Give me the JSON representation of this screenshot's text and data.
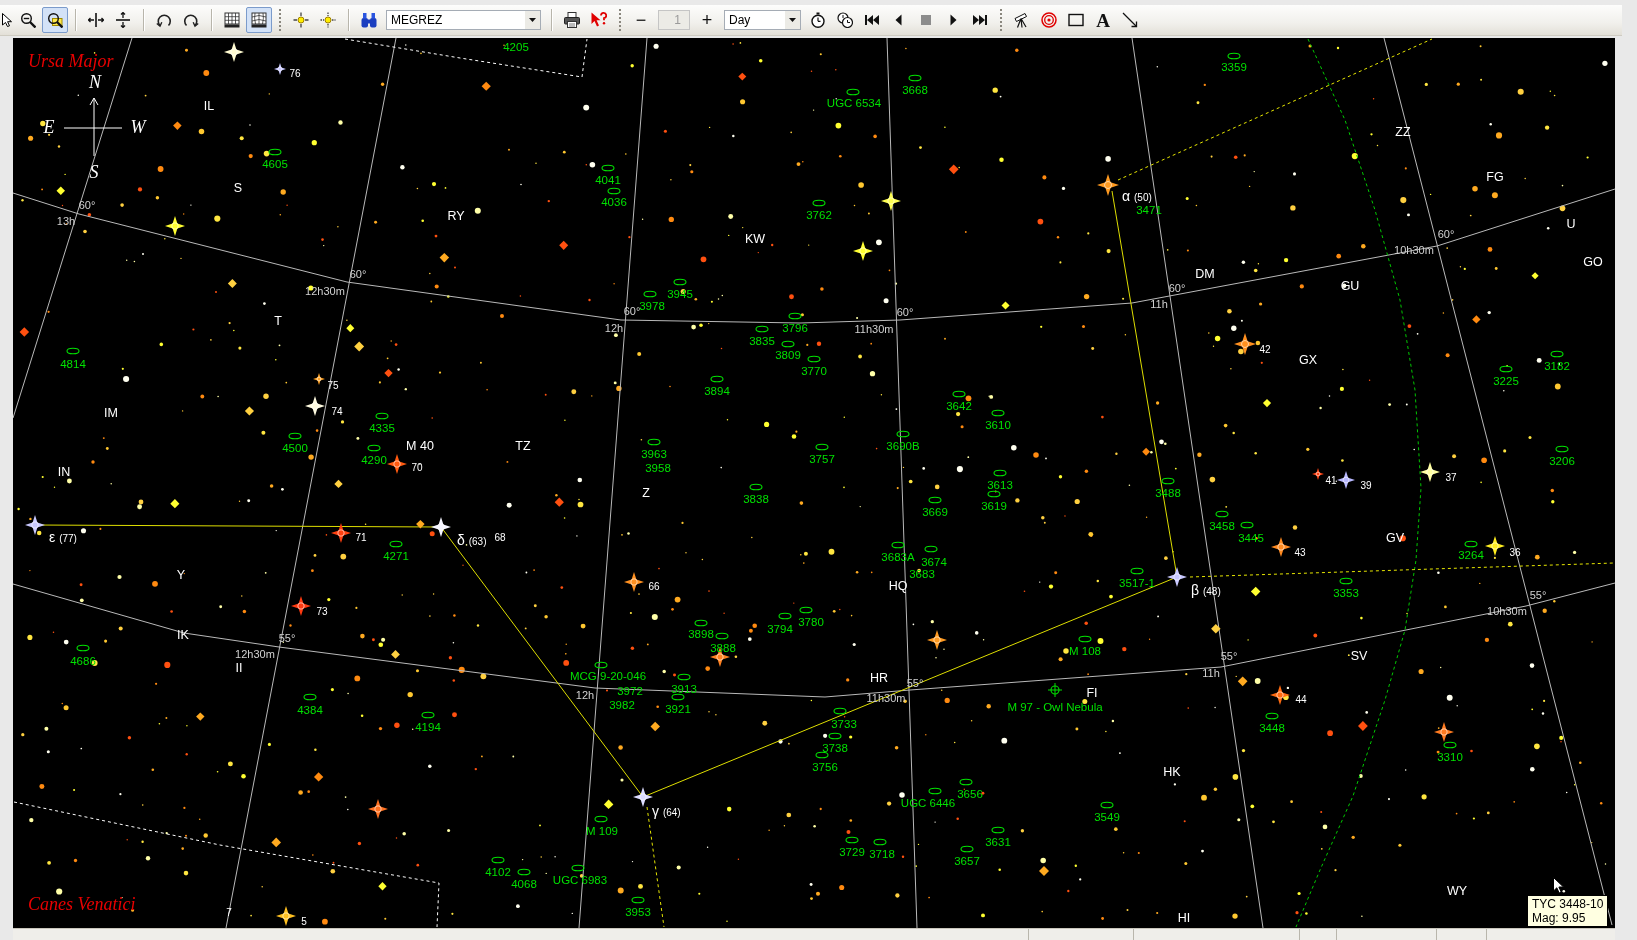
{
  "toolbar": {
    "items": [
      {
        "kind": "pointer",
        "selected": false
      },
      {
        "kind": "zoomout",
        "selected": false
      },
      {
        "kind": "zoomwindow",
        "selected": true
      },
      {
        "kind": "separator"
      },
      {
        "kind": "fliph",
        "selected": false
      },
      {
        "kind": "flipv",
        "selected": false
      },
      {
        "kind": "separator"
      },
      {
        "kind": "rotleft",
        "selected": false
      },
      {
        "kind": "rotright",
        "selected": false
      },
      {
        "kind": "separator"
      },
      {
        "kind": "grid",
        "selected": false
      },
      {
        "kind": "gridcurved",
        "selected": true
      },
      {
        "kind": "grip"
      },
      {
        "kind": "centera",
        "selected": false
      },
      {
        "kind": "centerb",
        "selected": false
      },
      {
        "kind": "separator"
      },
      {
        "kind": "binoculars",
        "selected": false
      },
      {
        "kind": "objectbox",
        "value": "MEGREZ"
      },
      {
        "kind": "separator"
      },
      {
        "kind": "print",
        "selected": false
      },
      {
        "kind": "help",
        "selected": false
      },
      {
        "kind": "grip"
      },
      {
        "kind": "minus",
        "label": "−",
        "selected": false
      },
      {
        "kind": "stepbox",
        "value": "1",
        "disabled": true
      },
      {
        "kind": "plus",
        "label": "+",
        "selected": false
      },
      {
        "kind": "unitbox",
        "value": "Day"
      },
      {
        "kind": "stopwatch",
        "selected": false
      },
      {
        "kind": "clocks",
        "selected": false
      },
      {
        "kind": "rewind",
        "selected": false
      },
      {
        "kind": "stepback",
        "selected": false
      },
      {
        "kind": "stop",
        "selected": false
      },
      {
        "kind": "stepforward",
        "selected": false
      },
      {
        "kind": "fastforward",
        "selected": false
      },
      {
        "kind": "grip"
      },
      {
        "kind": "telescope",
        "selected": false
      },
      {
        "kind": "target",
        "selected": false
      },
      {
        "kind": "rectangle",
        "selected": false
      },
      {
        "kind": "text",
        "label": "A",
        "selected": false
      },
      {
        "kind": "line",
        "selected": false
      }
    ]
  },
  "chart": {
    "constellation_labels": [
      "Ursa Major",
      "Canes Venatici"
    ],
    "compass": {
      "north": "N",
      "east": "E",
      "west": "W",
      "south": "S"
    },
    "grid_labels": [
      "60°",
      "13h",
      "60°",
      "12h30m",
      "60°",
      "12h",
      "60°",
      "11h30m",
      "60°",
      "11h",
      "60°",
      "10h30m",
      "55°",
      "12h30m",
      "12h",
      "55°",
      "11h30m",
      "55°",
      "11h",
      "55°",
      "10h30m"
    ],
    "star_labels": [
      {
        "kind": "number",
        "label": "76"
      },
      {
        "kind": "variable",
        "label": "IL"
      },
      {
        "kind": "variable",
        "label": "ZZ"
      },
      {
        "kind": "variable",
        "label": "FG"
      },
      {
        "kind": "variable",
        "label": "S"
      },
      {
        "kind": "variable",
        "label": "RY"
      },
      {
        "kind": "variable",
        "label": "U"
      },
      {
        "kind": "variable",
        "label": "KW"
      },
      {
        "kind": "variable",
        "label": "GO"
      },
      {
        "kind": "variable",
        "label": "DM"
      },
      {
        "kind": "variable",
        "label": "GU"
      },
      {
        "kind": "variable",
        "label": "T"
      },
      {
        "kind": "number",
        "label": "42"
      },
      {
        "kind": "variable",
        "label": "GX"
      },
      {
        "kind": "number",
        "label": "75"
      },
      {
        "kind": "variable",
        "label": "IM"
      },
      {
        "kind": "number",
        "label": "74"
      },
      {
        "kind": "variable",
        "label": "M 40"
      },
      {
        "kind": "variable",
        "label": "TZ"
      },
      {
        "kind": "variable",
        "label": "IN"
      },
      {
        "kind": "number",
        "label": "70"
      },
      {
        "kind": "number",
        "label": "41"
      },
      {
        "kind": "number",
        "label": "39"
      },
      {
        "kind": "number",
        "label": "37"
      },
      {
        "kind": "variable",
        "label": "Z"
      },
      {
        "kind": "number",
        "label": "71"
      },
      {
        "kind": "number",
        "label": "68"
      },
      {
        "kind": "variable",
        "label": "GV"
      },
      {
        "kind": "number",
        "label": "43"
      },
      {
        "kind": "number",
        "label": "36"
      },
      {
        "kind": "variable",
        "label": "Y"
      },
      {
        "kind": "number",
        "label": "66"
      },
      {
        "kind": "variable",
        "label": "HQ"
      },
      {
        "kind": "number",
        "label": "73"
      },
      {
        "kind": "variable",
        "label": "IK"
      },
      {
        "kind": "variable",
        "label": "SV"
      },
      {
        "kind": "variable",
        "label": "II"
      },
      {
        "kind": "variable",
        "label": "HR"
      },
      {
        "kind": "variable",
        "label": "FI"
      },
      {
        "kind": "number",
        "label": "44"
      },
      {
        "kind": "variable",
        "label": "HK"
      },
      {
        "kind": "variable",
        "label": "WY"
      },
      {
        "kind": "number",
        "label": "7"
      },
      {
        "kind": "number",
        "label": "5"
      },
      {
        "kind": "variable",
        "label": "HI"
      }
    ],
    "designations": [
      {
        "letter": "α",
        "number": "(50)"
      },
      {
        "letter": "ε",
        "number": "(77)"
      },
      {
        "letter": "δ",
        "number": "(63)"
      },
      {
        "letter": "β",
        "number": "(48)"
      },
      {
        "letter": "γ",
        "number": "(64)"
      }
    ],
    "deep_sky": [
      {
        "kind": "galaxy",
        "label": "4205"
      },
      {
        "kind": "galaxy",
        "label": "3359"
      },
      {
        "kind": "galaxy",
        "label": "3668"
      },
      {
        "kind": "galaxy",
        "label": "UGC 6534"
      },
      {
        "kind": "galaxy",
        "label": "4605"
      },
      {
        "kind": "galaxy",
        "label": "4041"
      },
      {
        "kind": "galaxy",
        "label": "4036"
      },
      {
        "kind": "galaxy",
        "label": "3762"
      },
      {
        "kind": "galaxy",
        "label": "3471"
      },
      {
        "kind": "galaxy",
        "label": "3945"
      },
      {
        "kind": "galaxy",
        "label": "3978"
      },
      {
        "kind": "galaxy",
        "label": "3796"
      },
      {
        "kind": "galaxy",
        "label": "3835"
      },
      {
        "kind": "galaxy",
        "label": "3809"
      },
      {
        "kind": "galaxy",
        "label": "4814"
      },
      {
        "kind": "galaxy",
        "label": "3770"
      },
      {
        "kind": "galaxy",
        "label": "3182"
      },
      {
        "kind": "galaxy",
        "label": "3225"
      },
      {
        "kind": "galaxy",
        "label": "3894"
      },
      {
        "kind": "galaxy",
        "label": "3642"
      },
      {
        "kind": "galaxy",
        "label": "4335"
      },
      {
        "kind": "galaxy",
        "label": "3610"
      },
      {
        "kind": "galaxy",
        "label": "4500"
      },
      {
        "kind": "galaxy",
        "label": "3963"
      },
      {
        "kind": "galaxy",
        "label": "3690B"
      },
      {
        "kind": "galaxy",
        "label": "4290"
      },
      {
        "kind": "galaxy",
        "label": "3958"
      },
      {
        "kind": "galaxy",
        "label": "3757"
      },
      {
        "kind": "galaxy",
        "label": "3206"
      },
      {
        "kind": "galaxy",
        "label": "3613"
      },
      {
        "kind": "galaxy",
        "label": "3838"
      },
      {
        "kind": "galaxy",
        "label": "3488"
      },
      {
        "kind": "galaxy",
        "label": "3669"
      },
      {
        "kind": "galaxy",
        "label": "3619"
      },
      {
        "kind": "galaxy",
        "label": "3458"
      },
      {
        "kind": "galaxy",
        "label": "3445"
      },
      {
        "kind": "galaxy",
        "label": "4271"
      },
      {
        "kind": "galaxy",
        "label": "3683A"
      },
      {
        "kind": "galaxy",
        "label": "3674"
      },
      {
        "kind": "galaxy",
        "label": "3264"
      },
      {
        "kind": "galaxy",
        "label": "3683"
      },
      {
        "kind": "galaxy",
        "label": "3517-1"
      },
      {
        "kind": "galaxy",
        "label": "3353"
      },
      {
        "kind": "galaxy",
        "label": "3794"
      },
      {
        "kind": "galaxy",
        "label": "3780"
      },
      {
        "kind": "galaxy",
        "label": "3898"
      },
      {
        "kind": "galaxy",
        "label": "3888"
      },
      {
        "kind": "galaxy",
        "label": "M 108"
      },
      {
        "kind": "galaxy",
        "label": "4686"
      },
      {
        "kind": "galaxy",
        "label": "MCG 9-20-046"
      },
      {
        "kind": "galaxy",
        "label": "3972"
      },
      {
        "kind": "galaxy",
        "label": "3913"
      },
      {
        "kind": "galaxy",
        "label": "4384"
      },
      {
        "kind": "galaxy",
        "label": "3982"
      },
      {
        "kind": "galaxy",
        "label": "3921"
      },
      {
        "kind": "nebula",
        "label": "M 97 - Owl Nebula"
      },
      {
        "kind": "galaxy",
        "label": "4194"
      },
      {
        "kind": "galaxy",
        "label": "3733"
      },
      {
        "kind": "galaxy",
        "label": "3448"
      },
      {
        "kind": "galaxy",
        "label": "3738"
      },
      {
        "kind": "galaxy",
        "label": "3310"
      },
      {
        "kind": "galaxy",
        "label": "3756"
      },
      {
        "kind": "galaxy",
        "label": "UGC 6446"
      },
      {
        "kind": "galaxy",
        "label": "3656"
      },
      {
        "kind": "galaxy",
        "label": "3549"
      },
      {
        "kind": "galaxy",
        "label": "M 109"
      },
      {
        "kind": "galaxy",
        "label": "3631"
      },
      {
        "kind": "galaxy",
        "label": "3729"
      },
      {
        "kind": "galaxy",
        "label": "3718"
      },
      {
        "kind": "galaxy",
        "label": "3657"
      },
      {
        "kind": "galaxy",
        "label": "4102"
      },
      {
        "kind": "galaxy",
        "label": "4068"
      },
      {
        "kind": "galaxy",
        "label": "UGC 6983"
      },
      {
        "kind": "galaxy",
        "label": "3953"
      }
    ],
    "tooltip": {
      "lines": [
        "TYC 3448-10",
        "Mag: 9.95"
      ]
    }
  }
}
